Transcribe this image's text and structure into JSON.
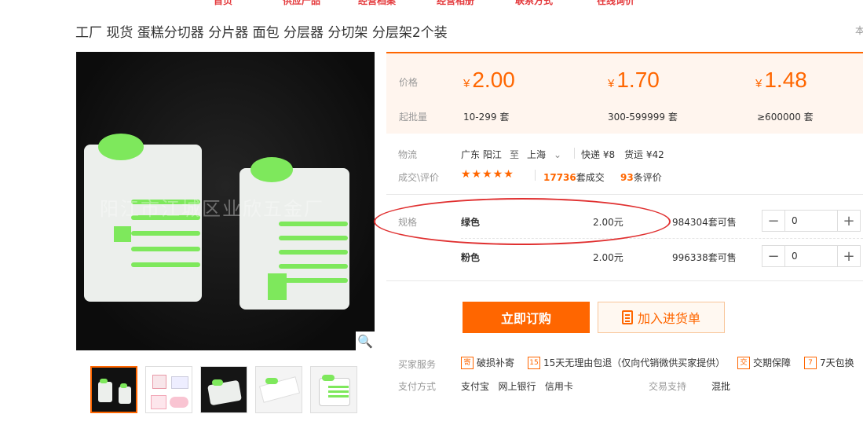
{
  "nav": {
    "items": [
      "首页",
      "供应产品",
      "经营档案",
      "经营相册",
      "联系方式",
      "在线询价"
    ]
  },
  "product": {
    "title": "工厂 现货 蛋糕分切器 分片器 面包 分层器 分切架 分层架2个装",
    "title_right": "本",
    "watermark": "阳江市江城区业欣五金厂"
  },
  "price_box": {
    "price_label": "价格",
    "min_label": "起批量",
    "currency": "¥",
    "tiers": [
      {
        "price": "2.00",
        "range": "10-299 套"
      },
      {
        "price": "1.70",
        "range": "300-599999 套"
      },
      {
        "price": "1.48",
        "range": "≥600000 套"
      }
    ]
  },
  "logistics": {
    "label": "物流",
    "from": "广东 阳江",
    "to_word": "至",
    "to": "上海",
    "express": "快递 ¥8",
    "freight": "货运 ¥42"
  },
  "deals": {
    "label": "成交\\评价",
    "stars": "★★★★★",
    "count": "17736",
    "count_suffix": "套成交",
    "reviews": "93",
    "reviews_suffix": "条评价"
  },
  "spec": {
    "label": "规格",
    "options": [
      {
        "name": "绿色",
        "price": "2.00元",
        "stock": "984304套可售",
        "qty": "0"
      },
      {
        "name": "粉色",
        "price": "2.00元",
        "stock": "996338套可售",
        "qty": "0"
      }
    ],
    "minus": "−",
    "plus": "+"
  },
  "actions": {
    "buy": "立即订购",
    "cart": "加入进货单"
  },
  "services": {
    "label": "买家服务",
    "items": [
      {
        "icon": "寄",
        "text": "破损补寄"
      },
      {
        "icon": "15",
        "text": "15天无理由包退（仅向代销微供买家提供）"
      },
      {
        "icon": "交",
        "text": "交期保障"
      },
      {
        "icon": "7",
        "text": "7天包换"
      }
    ]
  },
  "payment": {
    "label": "支付方式",
    "methods": "支付宝   网上银行   信用卡",
    "trade_label": "交易支持",
    "trade_value": "混批"
  },
  "colors": {
    "accent": "#ff6600",
    "price_bg": "#fff5ee",
    "highlight": "#e03030",
    "product_green": "#7ee85c"
  }
}
